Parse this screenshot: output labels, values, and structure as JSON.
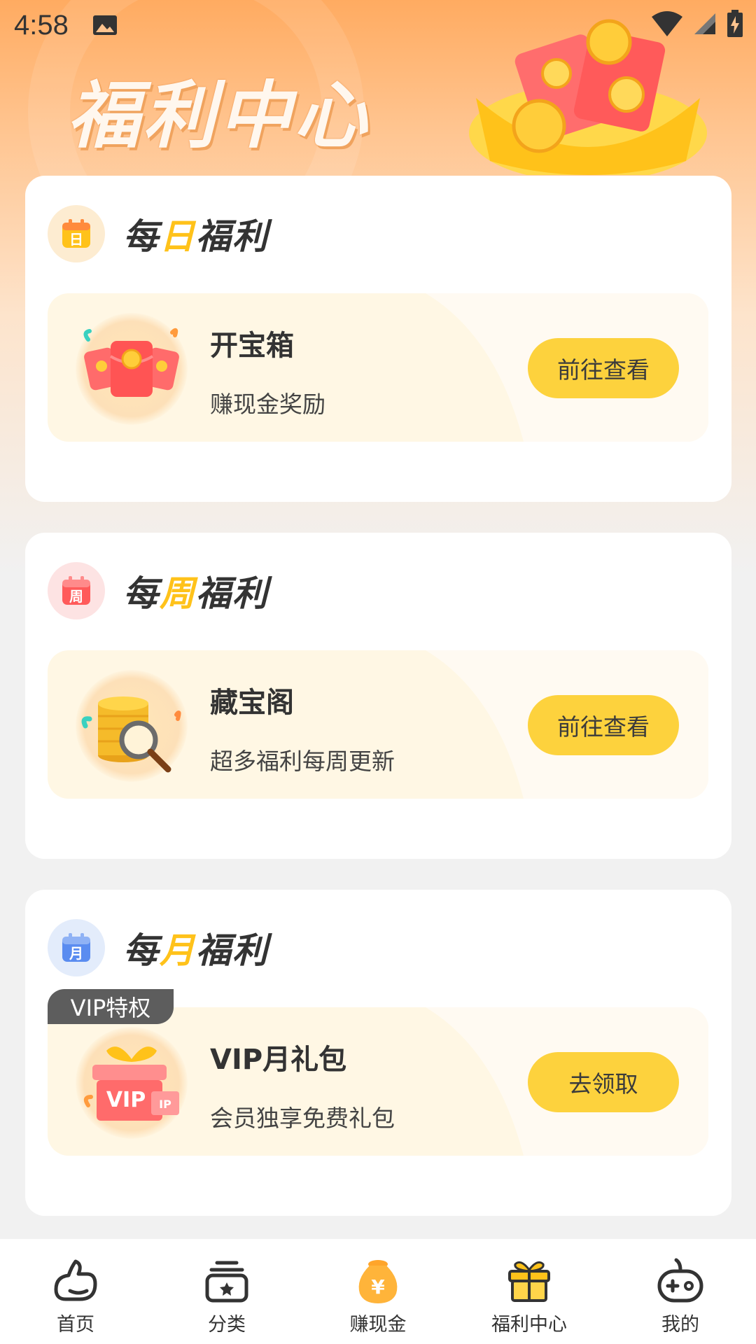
{
  "status_bar": {
    "time": "4:58",
    "icons": [
      "gallery-icon",
      "wifi-icon",
      "signal-icon",
      "battery-charging-icon"
    ]
  },
  "hero": {
    "title": "福利中心",
    "colors": {
      "gradient_top": "#ffab61",
      "gradient_bottom": "#f1f1f1"
    }
  },
  "sections": [
    {
      "title_pre": "每",
      "title_accent": "日",
      "title_post": "福利",
      "icon": "calendar-day-icon",
      "item": {
        "name": "开宝箱",
        "desc": "赚现金奖励",
        "button": "前往查看",
        "image": "red-envelopes-icon"
      }
    },
    {
      "title_pre": "每",
      "title_accent": "周",
      "title_post": "福利",
      "icon": "calendar-week-icon",
      "item": {
        "name": "藏宝阁",
        "desc": "超多福利每周更新",
        "button": "前往查看",
        "image": "coins-magnifier-icon"
      }
    },
    {
      "title_pre": "每",
      "title_accent": "月",
      "title_post": "福利",
      "icon": "calendar-month-icon",
      "badge": "VIP特权",
      "item": {
        "name": "VIP月礼包",
        "desc": "会员独享免费礼包",
        "button": "去领取",
        "image": "vip-gift-icon"
      }
    }
  ],
  "colors": {
    "accent_yellow": "#ffc21a",
    "button_yellow": "#fdd23d",
    "item_bg": "#fff7e4"
  },
  "bottom_nav": [
    {
      "label": "首页",
      "icon": "home-icon"
    },
    {
      "label": "分类",
      "icon": "category-icon"
    },
    {
      "label": "赚现金",
      "icon": "money-bag-icon"
    },
    {
      "label": "福利中心",
      "icon": "gift-icon"
    },
    {
      "label": "我的",
      "icon": "gamepad-icon"
    }
  ]
}
